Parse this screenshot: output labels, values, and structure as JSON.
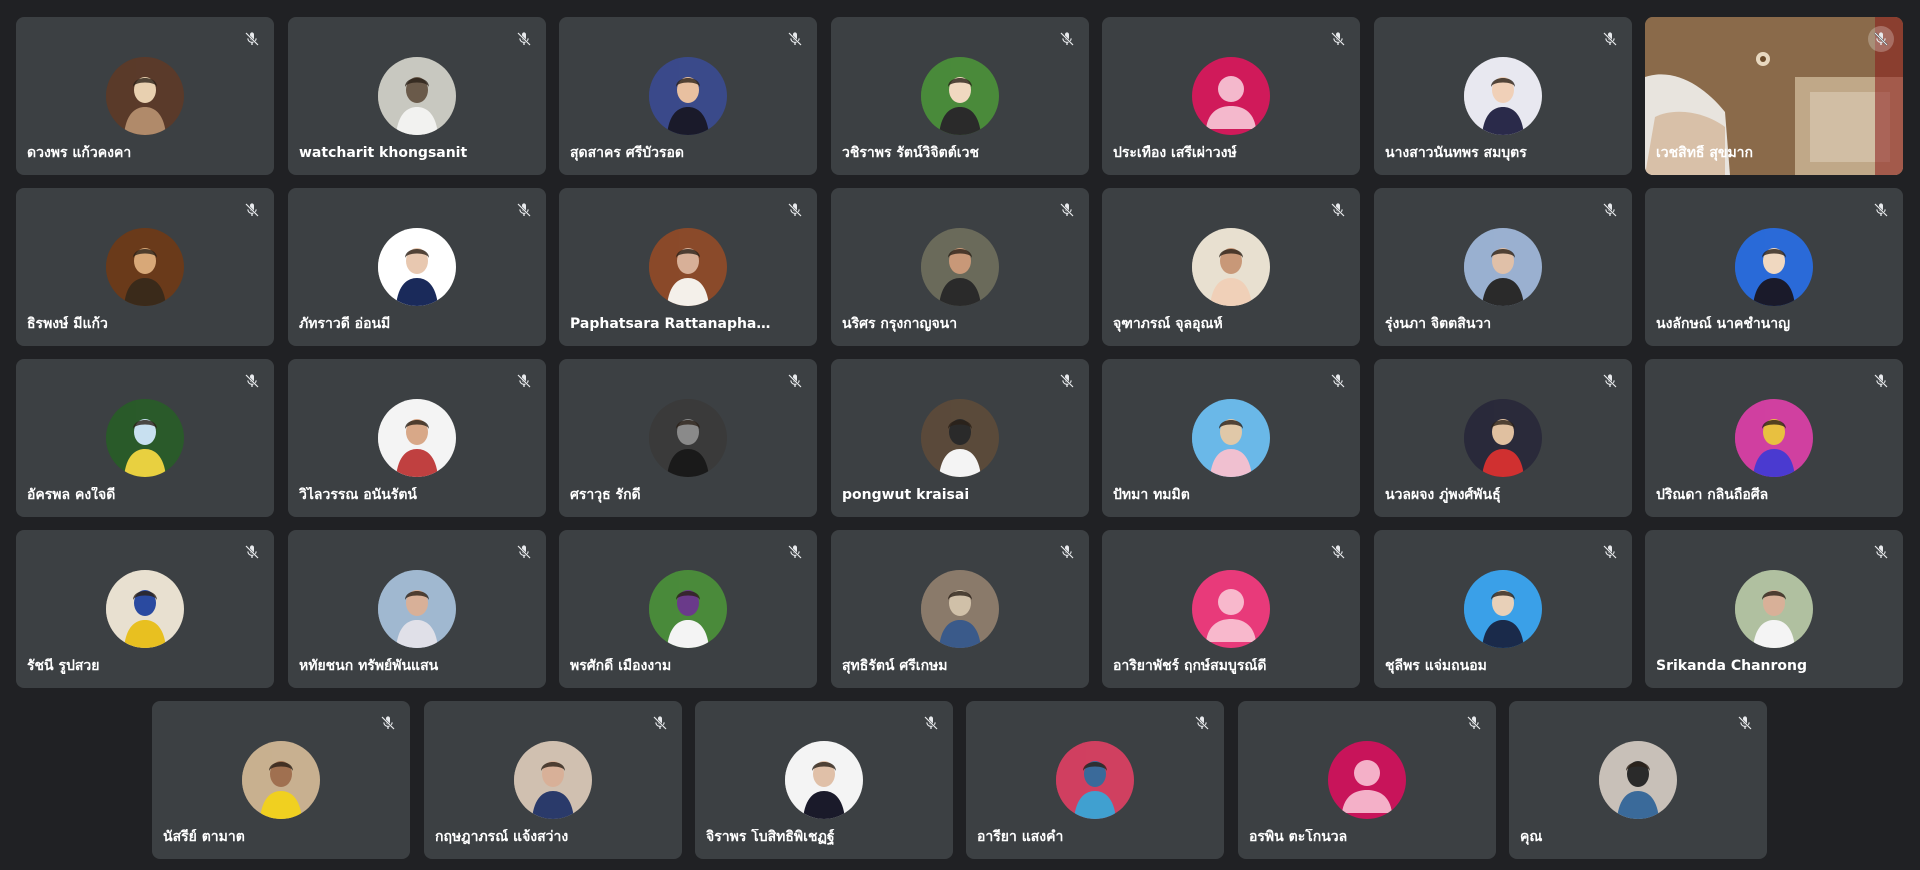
{
  "participants": [
    {
      "name": "ดวงพร แก้วคงคา",
      "avatar": "photo",
      "colors": [
        "#5a3a2a",
        "#b08a6a",
        "#e8d0b0"
      ]
    },
    {
      "name": "watcharit khongsanit",
      "avatar": "photo",
      "colors": [
        "#c8c8c0",
        "#f2f2f0",
        "#6a5a4a"
      ]
    },
    {
      "name": "สุดสาคร ศรีบัวรอด",
      "avatar": "photo",
      "colors": [
        "#3a4a8a",
        "#1a1a2a",
        "#e8c0a0"
      ]
    },
    {
      "name": "วชิราพร รัตน์วิจิตต์เวช",
      "avatar": "photo",
      "colors": [
        "#4a8a3a",
        "#2a2a2a",
        "#f0d8c0"
      ]
    },
    {
      "name": "ประเทือง เสรีเผ่าวงษ์",
      "avatar": "default",
      "colors": [
        "#d01a5a",
        "#f4b8cc",
        "#f4b8cc"
      ]
    },
    {
      "name": "นางสาวนันทพร สมบุตร",
      "avatar": "photo",
      "colors": [
        "#e8e8f0",
        "#2a2a4a",
        "#f0d0b8"
      ]
    },
    {
      "name": "เวชสิทธิ์ สุขมาก",
      "avatar": "video",
      "colors": [
        "#8a6a4a",
        "#d8c8b0",
        "#c0a080"
      ]
    },
    {
      "name": "ธิรพงษ์ มีแก้ว",
      "avatar": "photo",
      "colors": [
        "#6a3a1a",
        "#3a2a1a",
        "#d8a878"
      ]
    },
    {
      "name": "ภัทราวดี อ่อนมี",
      "avatar": "photo",
      "colors": [
        "#ffffff",
        "#1a2a5a",
        "#e8c8b0"
      ]
    },
    {
      "name": "Paphatsara Rattanaphakdee",
      "avatar": "photo",
      "colors": [
        "#8a4a2a",
        "#f4f0ea",
        "#d8b098"
      ]
    },
    {
      "name": "นริศร กรุงกาญจนา",
      "avatar": "photo",
      "colors": [
        "#6a6a5a",
        "#2a2a2a",
        "#c89878"
      ]
    },
    {
      "name": "จุฑาภรณ์ จุลอุณห์",
      "avatar": "photo",
      "colors": [
        "#e8e0d0",
        "#f0d0b8",
        "#c89878"
      ]
    },
    {
      "name": "รุ่งนภา จิตตสินวา",
      "avatar": "photo",
      "colors": [
        "#9ab0d0",
        "#2a2a2a",
        "#e0c0a8"
      ]
    },
    {
      "name": "นงลักษณ์ นาคชำนาญ",
      "avatar": "photo",
      "colors": [
        "#2a6ad8",
        "#1a1a2a",
        "#f0d8c0"
      ]
    },
    {
      "name": "อัครพล คงใจดี",
      "avatar": "photo",
      "colors": [
        "#2a5a2a",
        "#e8d040",
        "#c8e0f0"
      ]
    },
    {
      "name": "วิไลวรรณ อนันรัตน์",
      "avatar": "photo",
      "colors": [
        "#f4f4f4",
        "#c04040",
        "#d8a888"
      ]
    },
    {
      "name": "ศราวุธ รักดี",
      "avatar": "photo",
      "colors": [
        "#3a3a3a",
        "#1a1a1a",
        "#8a8a8a"
      ]
    },
    {
      "name": "pongwut kraisai",
      "avatar": "photo",
      "colors": [
        "#5a4a3a",
        "#f4f4f4",
        "#2a2a2a"
      ]
    },
    {
      "name": "ปัทมา ทมมิต",
      "avatar": "photo",
      "colors": [
        "#6ab8e8",
        "#f0c0d0",
        "#e0c8a8"
      ]
    },
    {
      "name": "นวลผจง ภู่พงศ์พันธุ์",
      "avatar": "photo",
      "colors": [
        "#2a2a3a",
        "#d03030",
        "#e0c0a0"
      ]
    },
    {
      "name": "ปริณดา กลิ่นถือศีล",
      "avatar": "photo",
      "colors": [
        "#d040a0",
        "#4a3ad0",
        "#e8c040"
      ]
    },
    {
      "name": "รัชนี รูปสวย",
      "avatar": "photo",
      "colors": [
        "#e8e0d0",
        "#e8c020",
        "#2a4aa0"
      ]
    },
    {
      "name": "หทัยชนก ทรัพย์พันแสน",
      "avatar": "photo",
      "colors": [
        "#a0b8d0",
        "#e0e0e8",
        "#d8b098"
      ]
    },
    {
      "name": "พรศักดิ์ เมืองงาม",
      "avatar": "photo",
      "colors": [
        "#4a8a3a",
        "#f4f4f4",
        "#6a3a8a"
      ]
    },
    {
      "name": "สุทธิรัตน์ ศรีเกษม",
      "avatar": "photo",
      "colors": [
        "#8a7a6a",
        "#3a5a8a",
        "#d0c0a8"
      ]
    },
    {
      "name": "อาริยาพัชร์ ฤกษ์สมบูรณ์ดี",
      "avatar": "default",
      "colors": [
        "#e83a7a",
        "#f8b8cc",
        "#f8b8cc"
      ]
    },
    {
      "name": "ชุลีพร แจ่มถนอม",
      "avatar": "photo",
      "colors": [
        "#3aa0e8",
        "#1a2a4a",
        "#e8d0b8"
      ]
    },
    {
      "name": "Srikanda Chanrong",
      "avatar": "photo",
      "colors": [
        "#b0c0a0",
        "#f4f4f4",
        "#d8b098"
      ]
    },
    {
      "name": "นัสรีย์ ตามาต",
      "avatar": "photo",
      "colors": [
        "#c8b090",
        "#f0d020",
        "#a07050"
      ]
    },
    {
      "name": "กฤษฎาภรณ์ แจ้งสว่าง",
      "avatar": "photo",
      "colors": [
        "#d0c0b0",
        "#2a3a6a",
        "#d8b098"
      ]
    },
    {
      "name": "จิราพร โบสิทธิพิเชฏฐ์",
      "avatar": "photo",
      "colors": [
        "#f4f4f4",
        "#1a1a2a",
        "#e0c0a8"
      ]
    },
    {
      "name": "อารียา แสงคำ",
      "avatar": "photo",
      "colors": [
        "#d04060",
        "#40a0d0",
        "#3a6a9a"
      ]
    },
    {
      "name": "อรพิน ตะโกนวล",
      "avatar": "default",
      "colors": [
        "#c8145a",
        "#f4b0c8",
        "#f4b0c8"
      ]
    },
    {
      "name": "คุณ",
      "avatar": "photo",
      "colors": [
        "#c8c0b8",
        "#3a6a9a",
        "#2a2a2a"
      ]
    }
  ],
  "icons": {
    "mic": "mic-off-icon"
  },
  "theme": {
    "background": "#202124",
    "tile": "#3c4043",
    "text": "#ffffff",
    "icon": "#e8eaed"
  }
}
